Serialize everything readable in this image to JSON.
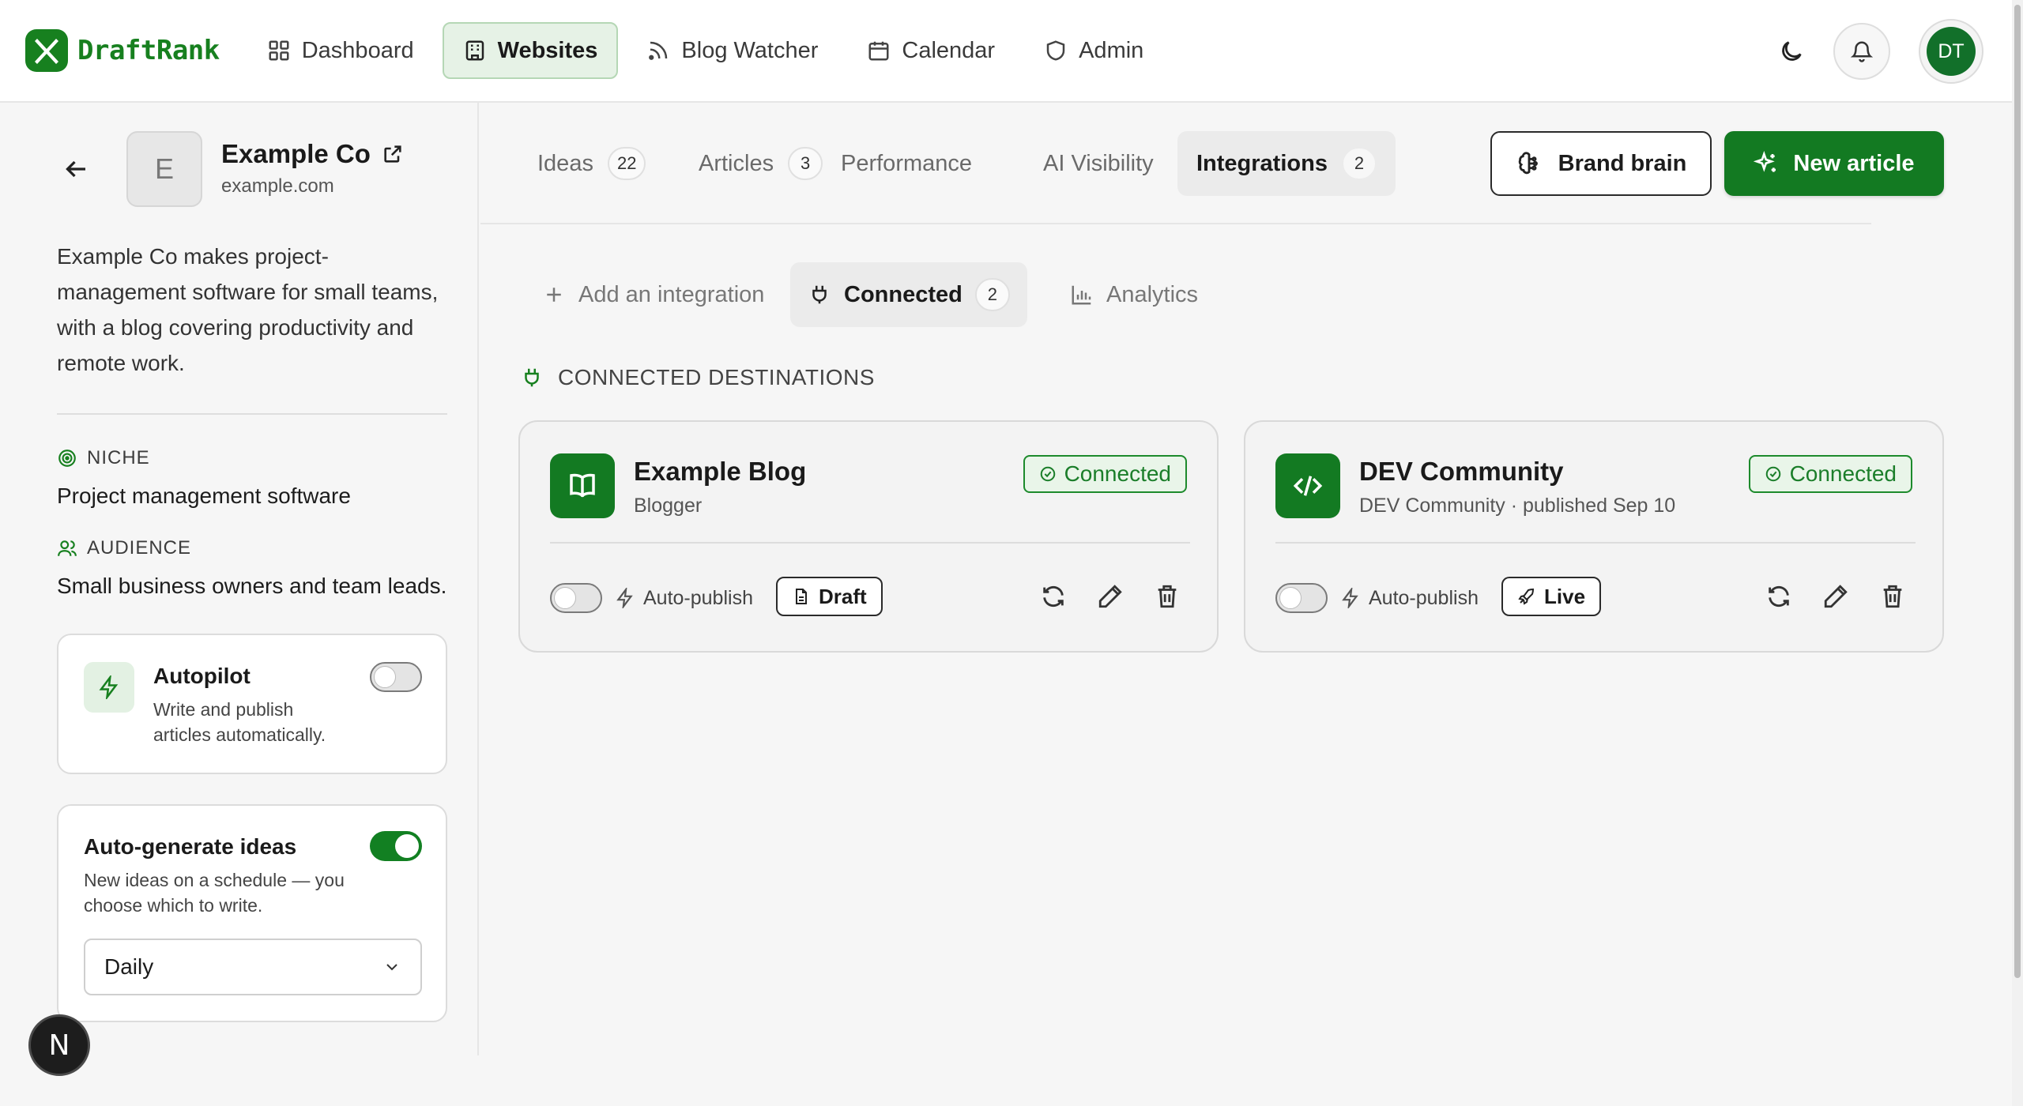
{
  "brand": {
    "name": "DraftRank",
    "accent": "#137a22"
  },
  "nav": {
    "items": [
      {
        "label": "Dashboard",
        "icon": "grid-icon"
      },
      {
        "label": "Websites",
        "icon": "building-icon",
        "active": true
      },
      {
        "label": "Blog Watcher",
        "icon": "rss-icon"
      },
      {
        "label": "Calendar",
        "icon": "calendar-icon"
      },
      {
        "label": "Admin",
        "icon": "shield-icon"
      }
    ],
    "user_initials": "DT"
  },
  "site": {
    "initial": "E",
    "name": "Example Co",
    "domain": "example.com",
    "description": "Example Co makes project-management software for small teams, with a blog covering productivity and remote work.",
    "niche_label": "NICHE",
    "niche": "Project management software",
    "audience_label": "AUDIENCE",
    "audience": "Small business owners and team leads."
  },
  "autopilot": {
    "title": "Autopilot",
    "subtitle": "Write and publish articles automatically.",
    "enabled": false
  },
  "autogen": {
    "title": "Auto-generate ideas",
    "subtitle": "New ideas on a schedule — you choose which to write.",
    "enabled": true,
    "frequency": "Daily"
  },
  "tabs": [
    {
      "label": "Ideas",
      "count": "22"
    },
    {
      "label": "Articles",
      "count": "3"
    },
    {
      "label": "Performance"
    },
    {
      "label": "AI Visibility"
    },
    {
      "label": "Integrations",
      "count": "2",
      "active": true
    }
  ],
  "actions": {
    "brand_brain": "Brand brain",
    "new_article": "New article"
  },
  "subtabs": [
    {
      "label": "Add an integration",
      "icon": "plus-icon"
    },
    {
      "label": "Connected",
      "count": "2",
      "icon": "plug-icon",
      "active": true
    },
    {
      "label": "Analytics",
      "icon": "bar-chart-icon"
    }
  ],
  "section_title": "CONNECTED DESTINATIONS",
  "destinations": [
    {
      "name": "Example Blog",
      "subtitle": "Blogger",
      "status": "Connected",
      "autopublish_label": "Auto-publish",
      "autopublish": false,
      "mode": "Draft",
      "icon": "book-icon"
    },
    {
      "name": "DEV Community",
      "subtitle": "DEV Community · published Sep 10",
      "status": "Connected",
      "autopublish_label": "Auto-publish",
      "autopublish": false,
      "mode": "Live",
      "icon": "code-icon"
    }
  ],
  "dev_badge": "N"
}
